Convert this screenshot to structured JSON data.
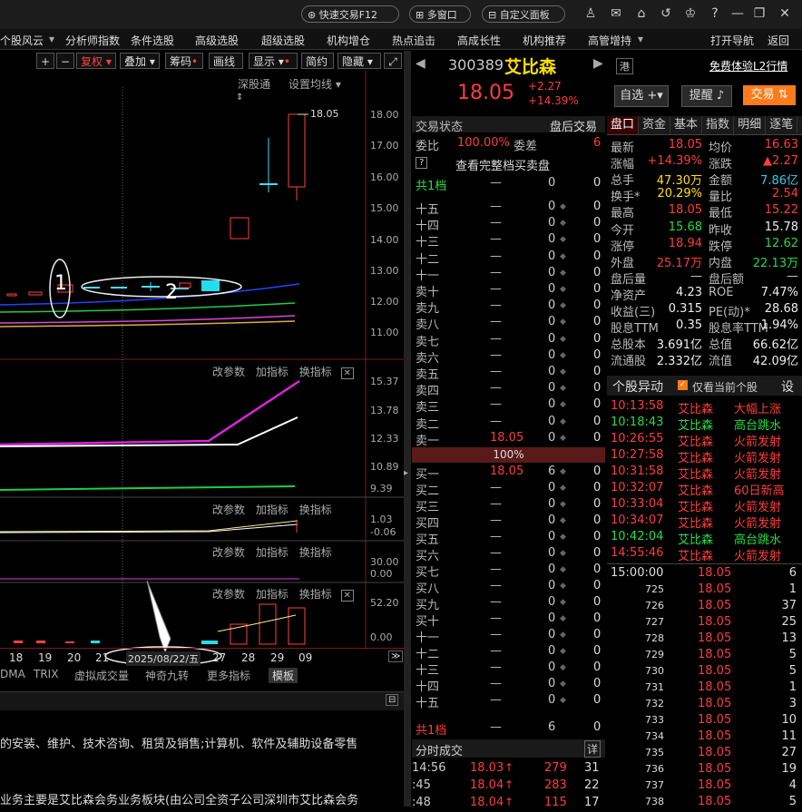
{
  "topbar": {
    "quick_trade": "快速交易F12",
    "multi_window": "多窗口",
    "custom_panel": "自定义面板"
  },
  "menu": [
    "个股风云",
    "分析师指数",
    "条件选股",
    "高级选股",
    "超级选股",
    "机构增仓",
    "热点追击",
    "高成长性",
    "机构推荐",
    "高管增持",
    "打开导航",
    "返回"
  ],
  "chart_toolbar": {
    "fuquan": "复权",
    "overlay": "叠加",
    "chip": "筹码",
    "draw": "画线",
    "display": "显示",
    "simple": "简约",
    "hide": "隐藏",
    "shentong": "深股通",
    "ma_setting": "设置均线"
  },
  "price_axis": [
    "18.00",
    "17.00",
    "16.00",
    "15.00",
    "14.00",
    "13.00",
    "12.00",
    "11.00"
  ],
  "high_label": "18.05",
  "annotations": {
    "one": "1",
    "two": "2"
  },
  "indicator_panels": [
    {
      "edit": "改参数",
      "add": "加指标",
      "switch": "换指标",
      "ticks": [
        "15.37",
        "13.78",
        "12.33",
        "10.89",
        "9.39"
      ]
    },
    {
      "edit": "改参数",
      "add": "加指标",
      "switch": "换指标",
      "ticks": [
        "1.03",
        "-0.06"
      ]
    },
    {
      "edit": "改参数",
      "add": "加指标",
      "switch": "换指标",
      "ticks": [
        "30.00",
        "0.00"
      ]
    },
    {
      "edit": "改参数",
      "add": "加指标",
      "switch": "换指标",
      "ticks": [
        "52.20",
        "0.00"
      ]
    }
  ],
  "x_axis": [
    "18",
    "19",
    "20",
    "21",
    "27",
    "28",
    "29",
    "09"
  ],
  "x_cursor_date": "2025/08/22/五",
  "bottom_tabs": [
    "DMA",
    "TRIX",
    "虚拟成交量",
    "神奇九转",
    "更多指标",
    "模板"
  ],
  "info_text": [
    "的安装、维护、技术咨询、租赁及销售;计算机、软件及辅助设备零售",
    "业务主要是艾比森会务业务板块(由公司全资子公司深圳市艾比森会务"
  ],
  "stock": {
    "code": "300389",
    "name": "艾比森",
    "hk": "港",
    "l2": "免费体验L2行情",
    "price": "18.05",
    "change": "+2.27",
    "pct": "+14.39%",
    "zixuan": "自选",
    "remind": "提醒",
    "trade": "交易"
  },
  "orderbook": {
    "status_label": "交易状态",
    "status_value": "盘后交易",
    "weibi_label": "委比",
    "weibi_value": "100.00%",
    "weicha_label": "委差",
    "weicha_value": "6",
    "full_order": "查看完整档买卖盘",
    "top_label": "共1档",
    "top_dash": "—",
    "top_vol": "0",
    "top_n": "0",
    "sells": [
      "十五",
      "十四",
      "十三",
      "十二",
      "十一",
      "卖十",
      "卖九",
      "卖八",
      "卖七",
      "卖六",
      "卖五",
      "卖四",
      "卖三",
      "卖二",
      "卖一"
    ],
    "sell1_price": "18.05",
    "ratio": "100%",
    "buys": [
      "买一",
      "买二",
      "买三",
      "买四",
      "买五",
      "买六",
      "买七",
      "买八",
      "买九",
      "买十",
      "十一",
      "十二",
      "十三",
      "十四",
      "十五"
    ],
    "buy1_price": "18.05",
    "buy1_vol": "6",
    "bottom_label": "共1档",
    "bottom_dash": "—",
    "bottom_vol": "6",
    "bottom_n": "0",
    "dash": "—",
    "zero": "0"
  },
  "ticks_panel": {
    "title": "分时成交",
    "detail": "详",
    "rows": [
      {
        "time": "14:56",
        "price": "18.03",
        "vol": "279",
        "n": "31"
      },
      {
        "time": ":45",
        "price": "18.04",
        "vol": "283",
        "n": "22"
      },
      {
        "time": ":48",
        "price": "18.04",
        "vol": "115",
        "n": "17"
      }
    ]
  },
  "quote_tabs": [
    "盘口",
    "资金",
    "基本",
    "指数",
    "明细",
    "逐笔"
  ],
  "quote": [
    [
      "最新",
      "18.05",
      "均价",
      "16.63"
    ],
    [
      "涨幅",
      "+14.39%",
      "涨跌",
      "▲2.27"
    ],
    [
      "总手",
      "47.30万",
      "金额",
      "7.86亿"
    ],
    [
      "换手*",
      "20.29%",
      "量比",
      "2.54"
    ],
    [
      "最高",
      "18.05",
      "最低",
      "15.22"
    ],
    [
      "今开",
      "15.68",
      "昨收",
      "15.78"
    ],
    [
      "涨停",
      "18.94",
      "跌停",
      "12.62"
    ],
    [
      "外盘",
      "25.17万",
      "内盘",
      "22.13万"
    ],
    [
      "盘后量",
      "—",
      "盘后额",
      "—"
    ],
    [
      "净资产",
      "4.23",
      "ROE",
      "7.47%"
    ],
    [
      "收益(三)",
      "0.315",
      "PE(动)*",
      "28.68"
    ],
    [
      "股息TTM",
      "0.35",
      "股息率TTM",
      "1.94%"
    ],
    [
      "总股本",
      "3.691亿",
      "总值",
      "66.62亿"
    ],
    [
      "流通股",
      "2.332亿",
      "流值",
      "42.09亿"
    ]
  ],
  "abnormal": {
    "title": "个股异动",
    "only_current": "仅看当前个股",
    "set": "设",
    "rows": [
      {
        "time": "10:13:58",
        "name": "艾比森",
        "event": "大幅上涨",
        "color": "#ff3b3b"
      },
      {
        "time": "10:18:43",
        "name": "艾比森",
        "event": "高台跳水",
        "color": "#22dd44"
      },
      {
        "time": "10:26:55",
        "name": "艾比森",
        "event": "火箭发射",
        "color": "#ff3b3b"
      },
      {
        "time": "10:27:58",
        "name": "艾比森",
        "event": "火箭发射",
        "color": "#ff3b3b"
      },
      {
        "time": "10:31:58",
        "name": "艾比森",
        "event": "火箭发射",
        "color": "#ff3b3b"
      },
      {
        "time": "10:32:07",
        "name": "艾比森",
        "event": "60日新高",
        "color": "#ff3b3b"
      },
      {
        "time": "10:33:04",
        "name": "艾比森",
        "event": "火箭发射",
        "color": "#ff3b3b"
      },
      {
        "time": "10:34:07",
        "name": "艾比森",
        "event": "火箭发射",
        "color": "#ff3b3b"
      },
      {
        "time": "10:42:04",
        "name": "艾比森",
        "event": "高台跳水",
        "color": "#22dd44"
      },
      {
        "time": "14:55:46",
        "name": "艾比森",
        "event": "火箭发射",
        "color": "#ff3b3b"
      }
    ]
  },
  "trades": [
    {
      "t": "15:00:00",
      "p": "18.05",
      "v": "6"
    },
    {
      "t": "725",
      "p": "18.05",
      "v": "1"
    },
    {
      "t": "726",
      "p": "18.05",
      "v": "37"
    },
    {
      "t": "727",
      "p": "18.05",
      "v": "25"
    },
    {
      "t": "728",
      "p": "18.05",
      "v": "13"
    },
    {
      "t": "729",
      "p": "18.05",
      "v": "5"
    },
    {
      "t": "730",
      "p": "18.05",
      "v": "5"
    },
    {
      "t": "731",
      "p": "18.05",
      "v": "1"
    },
    {
      "t": "732",
      "p": "18.05",
      "v": "3"
    },
    {
      "t": "733",
      "p": "18.05",
      "v": "10"
    },
    {
      "t": "734",
      "p": "18.05",
      "v": "11"
    },
    {
      "t": "735",
      "p": "18.05",
      "v": "27"
    },
    {
      "t": "736",
      "p": "18.05",
      "v": "19"
    },
    {
      "t": "737",
      "p": "18.05",
      "v": "4"
    },
    {
      "t": "738",
      "p": "18.05",
      "v": "5"
    }
  ]
}
